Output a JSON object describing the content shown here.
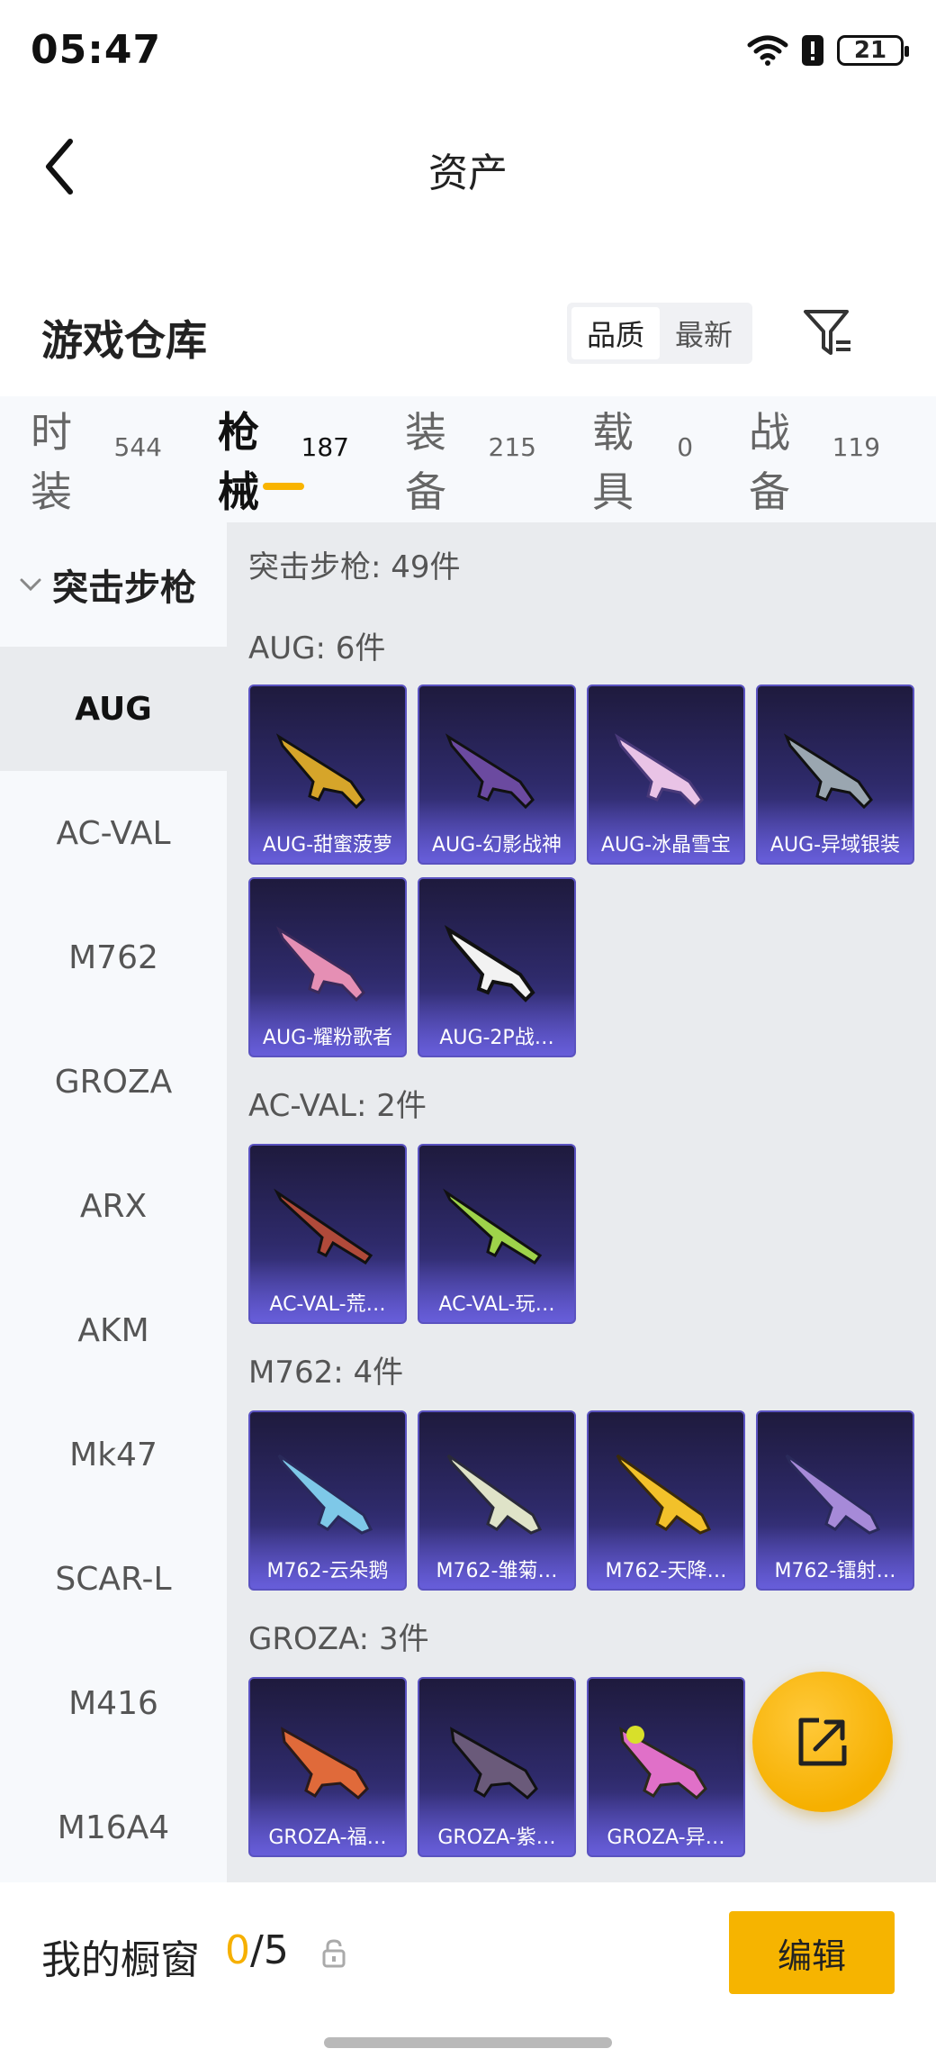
{
  "status_bar": {
    "time": "05:47",
    "battery": "21"
  },
  "header": {
    "title": "资产"
  },
  "warehouse": {
    "title": "游戏仓库",
    "sort_options": [
      "品质",
      "最新"
    ],
    "active_sort": "品质"
  },
  "tabs": [
    {
      "label": "时装",
      "count": "544"
    },
    {
      "label": "枪械",
      "count": "187",
      "active": true
    },
    {
      "label": "装备",
      "count": "215"
    },
    {
      "label": "载具",
      "count": "0"
    },
    {
      "label": "战备",
      "count": "119"
    }
  ],
  "sidebar": {
    "header": "突击步枪",
    "items": [
      "AUG",
      "AC-VAL",
      "M762",
      "GROZA",
      "ARX",
      "AKM",
      "Mk47",
      "SCAR-L",
      "M416",
      "M16A4"
    ],
    "active": "AUG"
  },
  "main": {
    "summary": "突击步枪: 49件",
    "groups": [
      {
        "title": "AUG: 6件",
        "items": [
          "AUG-甜蜜菠萝",
          "AUG-幻影战神",
          "AUG-冰晶雪宝",
          "AUG-异域银装",
          "AUG-耀粉歌者",
          "AUG-2P战…"
        ]
      },
      {
        "title": "AC-VAL: 2件",
        "items": [
          "AC-VAL-荒…",
          "AC-VAL-玩…"
        ]
      },
      {
        "title": "M762: 4件",
        "items": [
          "M762-云朵鹅",
          "M762-雏菊…",
          "M762-天降…",
          "M762-镭射…"
        ]
      },
      {
        "title": "GROZA: 3件",
        "items": [
          "GROZA-福…",
          "GROZA-紫…",
          "GROZA-异…"
        ]
      }
    ]
  },
  "bottom_bar": {
    "title": "我的橱窗",
    "count_current": "0",
    "count_sep_total": "/5",
    "edit_label": "编辑"
  },
  "colors": {
    "accent": "#f6b400",
    "card_bg": "#2e2a6a"
  }
}
